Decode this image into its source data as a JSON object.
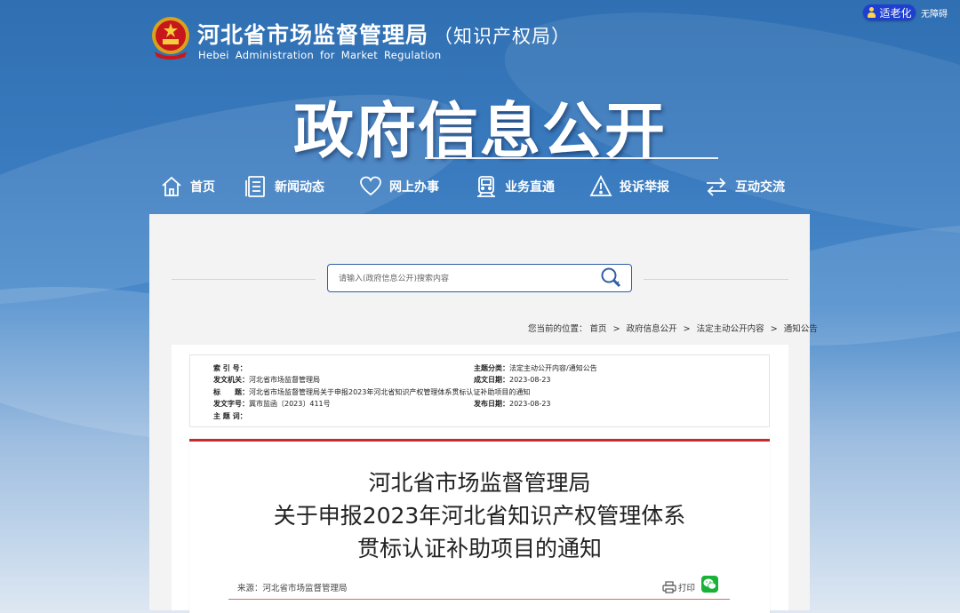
{
  "header": {
    "elder_mode": "适老化",
    "accessibility": "无障碍",
    "site_name_cn": "河北省市场监督管理局",
    "site_name_cn_sub": "（知识产权局）",
    "site_name_en": "Hebei Administration for Market Regulation",
    "section_title": "政府信息公开"
  },
  "nav": [
    {
      "label": "首页",
      "icon": "home-icon"
    },
    {
      "label": "新闻动态",
      "icon": "news-icon"
    },
    {
      "label": "网上办事",
      "icon": "heart-icon"
    },
    {
      "label": "业务直通",
      "icon": "train-icon"
    },
    {
      "label": "投诉举报",
      "icon": "warning-icon"
    },
    {
      "label": "互动交流",
      "icon": "exchange-icon"
    }
  ],
  "search": {
    "placeholder": "请输入(政府信息公开)搜索内容"
  },
  "breadcrumb": {
    "prefix": "您当前的位置：",
    "items": [
      "首页",
      "政府信息公开",
      "法定主动公开内容",
      "通知公告"
    ],
    "separator": ">"
  },
  "meta": {
    "index_no_label": "索 引 号：",
    "index_no": "",
    "category_label": "主题分类：",
    "category": "法定主动公开内容/通知公告",
    "issuer_label": "发文机关：",
    "issuer": "河北省市场监督管理局",
    "created_label": "成文日期：",
    "created": "2023-08-23",
    "title_label": "标　　题：",
    "title": "河北省市场监督管理局关于申报2023年河北省知识产权管理体系贯标认证补助项目的通知",
    "doc_no_label": "发文字号：",
    "doc_no": "冀市监函〔2023〕411号",
    "published_label": "发布日期：",
    "published": "2023-08-23",
    "keywords_label": "主 题 词：",
    "keywords": ""
  },
  "article": {
    "title_lines": [
      "河北省市场监督管理局",
      "关于申报2023年河北省知识产权管理体系",
      "贯标认证补助项目的通知"
    ],
    "source_label": "来源：",
    "source": "河北省市场监督管理局",
    "print_label": "打印"
  },
  "colors": {
    "nav_bg": "#3b7cc0",
    "accent_red": "#c62b2b",
    "search_border": "#2f5fa6",
    "elder_btn": "#1f3fd1"
  }
}
